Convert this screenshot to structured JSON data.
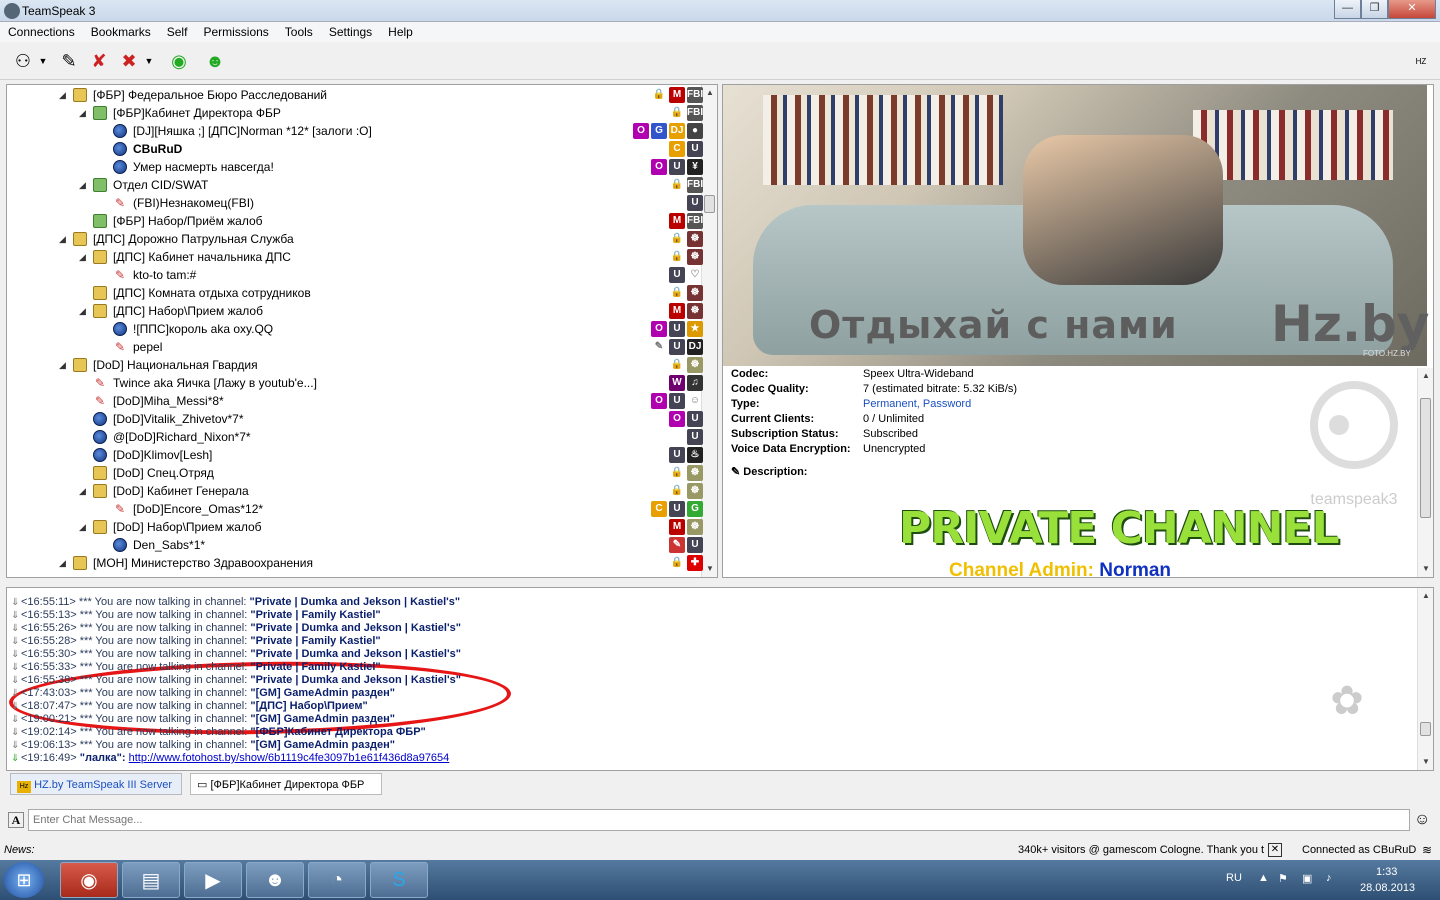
{
  "window": {
    "title": "TeamSpeak 3"
  },
  "menu": [
    "Connections",
    "Bookmarks",
    "Self",
    "Permissions",
    "Tools",
    "Settings",
    "Help"
  ],
  "tree": [
    {
      "indent": 0,
      "exp": "◢",
      "icon": "ch",
      "label": "[ФБР] Федеральное Бюро Расследований",
      "badges": [
        [
          "FBI",
          "#555"
        ],
        [
          "M",
          "#b00"
        ],
        [
          "🔒",
          "#777"
        ]
      ]
    },
    {
      "indent": 1,
      "exp": "◢",
      "icon": "ch2",
      "label": "[ФБР]Кабинет Директора ФБР",
      "badges": [
        [
          "FBI",
          "#555"
        ],
        [
          "🔒",
          "#777"
        ]
      ]
    },
    {
      "indent": 2,
      "exp": "",
      "icon": "cl",
      "label": "[DJ][Няшка ;] [ДПС]Norman *12* [залоги :O]",
      "badges": [
        [
          "●",
          "#444"
        ],
        [
          "DJ",
          "#e8a000"
        ],
        [
          "G",
          "#3355cc"
        ],
        [
          "O",
          "#b000b0"
        ]
      ]
    },
    {
      "indent": 2,
      "exp": "",
      "icon": "cl",
      "label": "CBuRuD",
      "bold": true,
      "badges": [
        [
          "U",
          "#445"
        ],
        [
          "C",
          "#e8a000"
        ]
      ]
    },
    {
      "indent": 2,
      "exp": "",
      "icon": "cl",
      "label": "Умер насмерть навсегда!",
      "badges": [
        [
          "¥",
          "#222"
        ],
        [
          "U",
          "#445"
        ],
        [
          "O",
          "#b000b0"
        ]
      ]
    },
    {
      "indent": 1,
      "exp": "◢",
      "icon": "ch2",
      "label": "Отдел CID/SWAT",
      "badges": [
        [
          "FBI",
          "#555"
        ],
        [
          "🔒",
          "#777"
        ]
      ]
    },
    {
      "indent": 2,
      "exp": "",
      "icon": "mute",
      "label": "(FBI)Незнакомец(FBI)",
      "badges": [
        [
          "U",
          "#445"
        ]
      ]
    },
    {
      "indent": 1,
      "exp": "",
      "icon": "ch2",
      "label": "[ФБР] Набор/Приём жалоб",
      "badges": [
        [
          "FBI",
          "#555"
        ],
        [
          "M",
          "#b00"
        ]
      ]
    },
    {
      "indent": 0,
      "exp": "◢",
      "icon": "ch",
      "label": "[ДПС] Дорожно Патрульная Служба",
      "badges": [
        [
          "☸",
          "#733"
        ],
        [
          "🔒",
          "#777"
        ]
      ]
    },
    {
      "indent": 1,
      "exp": "◢",
      "icon": "ch",
      "label": "[ДПС] Кабинет начальника ДПС",
      "badges": [
        [
          "☸",
          "#733"
        ],
        [
          "🔒",
          "#777"
        ]
      ]
    },
    {
      "indent": 2,
      "exp": "",
      "icon": "mute",
      "label": "kto-to tam:#",
      "badges": [
        [
          "♡",
          "#999"
        ],
        [
          "U",
          "#445"
        ]
      ]
    },
    {
      "indent": 1,
      "exp": "",
      "icon": "ch",
      "label": "[ДПС] Комната отдыха сотрудников",
      "badges": [
        [
          "☸",
          "#733"
        ],
        [
          "🔒",
          "#777"
        ]
      ]
    },
    {
      "indent": 1,
      "exp": "◢",
      "icon": "ch",
      "label": "[ДПС] Набор\\Прием жалоб",
      "badges": [
        [
          "☸",
          "#733"
        ],
        [
          "M",
          "#b00"
        ]
      ]
    },
    {
      "indent": 2,
      "exp": "",
      "icon": "cl",
      "label": "![ППС]король aka oxy.QQ",
      "badges": [
        [
          "★",
          "#d90"
        ],
        [
          "U",
          "#445"
        ],
        [
          "O",
          "#b000b0"
        ]
      ]
    },
    {
      "indent": 2,
      "exp": "",
      "icon": "mute",
      "label": "pepel",
      "badges": [
        [
          "DJ",
          "#222"
        ],
        [
          "U",
          "#445"
        ],
        [
          "✎",
          "#777"
        ]
      ]
    },
    {
      "indent": 0,
      "exp": "◢",
      "icon": "ch",
      "label": "[DoD] Национальная Гвардия",
      "badges": [
        [
          "☸",
          "#996"
        ],
        [
          "🔒",
          "#777"
        ]
      ]
    },
    {
      "indent": 1,
      "exp": "",
      "icon": "mute",
      "label": "Twince aka Яичка [Лажу в youtub'e...]",
      "badges": [
        [
          "♫",
          "#333"
        ],
        [
          "W",
          "#700070"
        ]
      ]
    },
    {
      "indent": 1,
      "exp": "",
      "icon": "mute",
      "label": "[DoD]Miha_Messi*8*",
      "badges": [
        [
          "☺",
          "#777"
        ],
        [
          "U",
          "#445"
        ],
        [
          "O",
          "#b000b0"
        ]
      ]
    },
    {
      "indent": 1,
      "exp": "",
      "icon": "cl",
      "label": "[DoD]Vitalik_Zhivetov*7*",
      "badges": [
        [
          "U",
          "#445"
        ],
        [
          "O",
          "#b000b0"
        ]
      ]
    },
    {
      "indent": 1,
      "exp": "",
      "icon": "cl",
      "label": "@[DoD]Richard_Nixon*7*",
      "badges": [
        [
          "U",
          "#445"
        ]
      ]
    },
    {
      "indent": 1,
      "exp": "",
      "icon": "cl",
      "label": "[DoD]Klimov[Lesh]",
      "badges": [
        [
          "♨",
          "#222"
        ],
        [
          "U",
          "#445"
        ]
      ]
    },
    {
      "indent": 1,
      "exp": "",
      "icon": "ch",
      "label": "[DoD] Спец.Отряд",
      "badges": [
        [
          "☸",
          "#996"
        ],
        [
          "🔒",
          "#777"
        ]
      ]
    },
    {
      "indent": 1,
      "exp": "◢",
      "icon": "ch",
      "label": "[DoD] Кабинет Генерала",
      "badges": [
        [
          "☸",
          "#996"
        ],
        [
          "🔒",
          "#777"
        ]
      ]
    },
    {
      "indent": 2,
      "exp": "",
      "icon": "mute",
      "label": "[DoD]Encore_Omas*12*",
      "badges": [
        [
          "G",
          "#3a3"
        ],
        [
          "U",
          "#445"
        ],
        [
          "C",
          "#e8a000"
        ]
      ]
    },
    {
      "indent": 1,
      "exp": "◢",
      "icon": "ch",
      "label": "[DoD] Набор\\Прием жалоб",
      "badges": [
        [
          "☸",
          "#996"
        ],
        [
          "M",
          "#b00"
        ]
      ]
    },
    {
      "indent": 2,
      "exp": "",
      "icon": "cl",
      "label": "Den_Sabs*1*",
      "badges": [
        [
          "U",
          "#445"
        ],
        [
          "✎",
          "#c33"
        ]
      ]
    },
    {
      "indent": 0,
      "exp": "◢",
      "icon": "ch",
      "label": "[МОН] Министерство Здравоохранения",
      "badges": [
        [
          "✚",
          "#d00"
        ],
        [
          "🔒",
          "#777"
        ]
      ]
    }
  ],
  "banner": {
    "text": "Отдыхай с нами",
    "brand": "Hz.by",
    "credit": "FOTO.HZ.BY"
  },
  "channel_info": [
    {
      "k": "Codec:",
      "v": "Speex Ultra-Wideband"
    },
    {
      "k": "Codec Quality:",
      "v": "7 (estimated bitrate: 5.32 KiB/s)"
    },
    {
      "k": "Type:",
      "v": "Permanent, Password",
      "link": true
    },
    {
      "k": "Current Clients:",
      "v": "0 / Unlimited"
    },
    {
      "k": "Subscription Status:",
      "v": "Subscribed"
    },
    {
      "k": "Voice Data Encryption:",
      "v": "Unencrypted"
    }
  ],
  "description_label": "Description:",
  "private_title": "PRIVATE CHANNEL",
  "admin_label": "Channel Admin:",
  "admin_name": "Norman",
  "ts_logo": "teamspeak3",
  "chat_lines": [
    {
      "t": "<16:55:11>",
      "msg": "*** You are now talking in channel: ",
      "ch": "\"Private | Dumka and Jekson | Kastiel's\""
    },
    {
      "t": "<16:55:13>",
      "msg": "*** You are now talking in channel: ",
      "ch": "\"Private | Family Kastiel\""
    },
    {
      "t": "<16:55:26>",
      "msg": "*** You are now talking in channel: ",
      "ch": "\"Private | Dumka and Jekson | Kastiel's\""
    },
    {
      "t": "<16:55:28>",
      "msg": "*** You are now talking in channel: ",
      "ch": "\"Private | Family Kastiel\""
    },
    {
      "t": "<16:55:30>",
      "msg": "*** You are now talking in channel: ",
      "ch": "\"Private | Dumka and Jekson | Kastiel's\""
    },
    {
      "t": "<16:55:33>",
      "msg": "*** You are now talking in channel: ",
      "ch": "\"Private | Family Kastiel\""
    },
    {
      "t": "<16:55:38>",
      "msg": "*** You are now talking in channel: ",
      "ch": "\"Private | Dumka and Jekson | Kastiel's\""
    },
    {
      "t": "<17:43:03>",
      "msg": "*** You are now talking in channel: ",
      "ch": "\"[GM] GameAdmin разден\""
    },
    {
      "t": "<18:07:47>",
      "msg": "*** You are now talking in channel: ",
      "ch": "\"[ДПС] Набор\\Прием\""
    },
    {
      "t": "<19:00:21>",
      "msg": "*** You are now talking in channel: ",
      "ch": "\"[GM] GameAdmin разден\""
    },
    {
      "t": "<19:02:14>",
      "msg": "*** You are now talking in channel: ",
      "ch": "\"[ФБР]Кабинет Директора ФБР\""
    },
    {
      "t": "<19:06:13>",
      "msg": "*** You are now talking in channel: ",
      "ch": "\"[GM] GameAdmin разден\""
    },
    {
      "t": "<19:16:49>",
      "user": "\"лалка\":",
      "link": "http://www.fotohost.by/show/6b1119c4fe3097b1e61f436d8a97654"
    }
  ],
  "tabs": [
    {
      "label": "HZ.by TeamSpeak III Server"
    },
    {
      "label": "[ФБР]Кабинет Директора ФБР"
    }
  ],
  "chat_input": {
    "placeholder": "Enter Chat Message..."
  },
  "status": {
    "news_label": "News:",
    "ticker": "340k+ visitors @ gamescom Cologne. Thank you t",
    "connection": "Connected as CBuRuD"
  },
  "taskbar": {
    "lang": "RU",
    "time": "1:33",
    "date": "28.08.2013"
  },
  "colors": {
    "accent": "#0a1f6c",
    "link": "#0000cc",
    "highlight": "#e61616"
  }
}
